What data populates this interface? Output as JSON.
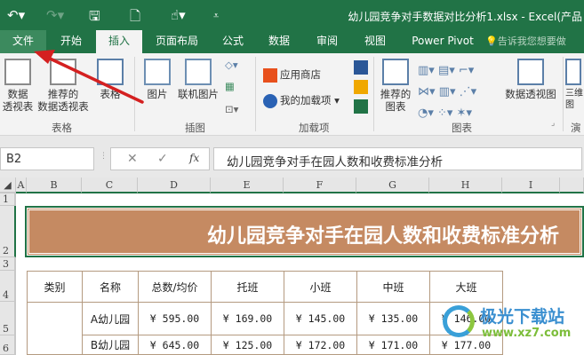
{
  "window": {
    "title": "幼儿园竞争对手数据对比分析1.xlsx - Excel(产品"
  },
  "tabs": [
    "文件",
    "开始",
    "插入",
    "页面布局",
    "公式",
    "数据",
    "审阅",
    "视图",
    "Power Pivot"
  ],
  "tell_me": "告诉我您想要做",
  "ribbon": {
    "table_group": {
      "label": "表格",
      "buttons": [
        "数据\n透视表",
        "推荐的\n数据透视表",
        "表格"
      ]
    },
    "illus_group": {
      "label": "插图",
      "buttons": [
        "图片",
        "联机图片"
      ]
    },
    "addins_group": {
      "label": "加载项",
      "store": "应用商店",
      "my_addins": "我的加载项"
    },
    "charts_group": {
      "label": "图表",
      "recommended": "推荐的\n图表",
      "pivot_chart": "数据透视图"
    },
    "next_group": {
      "label": "演",
      "button": "三维\n图"
    }
  },
  "formula_bar": {
    "name_box": "B2",
    "formula": "幼儿园竞争对手在园人数和收费标准分析",
    "fx": "fx"
  },
  "columns": [
    "A",
    "B",
    "C",
    "D",
    "E",
    "F",
    "G",
    "H",
    "I"
  ],
  "rows": [
    "1",
    "2",
    "3",
    "4",
    "5",
    "6"
  ],
  "sheet": {
    "banner": "幼儿园竞争对手在园人数和收费标准分析",
    "headers": [
      "类别",
      "名称",
      "总数/均价",
      "托班",
      "小班",
      "中班",
      "大班"
    ],
    "data": [
      [
        "",
        "A幼儿园",
        "¥  595.00",
        "¥  169.00",
        "¥  145.00",
        "¥  135.00",
        "¥  146.00"
      ],
      [
        "",
        "B幼儿园",
        "¥  645.00",
        "¥  125.00",
        "¥  172.00",
        "¥  171.00",
        "¥  177.00"
      ]
    ]
  },
  "watermark": {
    "name": "极光下载站",
    "url": "www.xz7.com"
  },
  "colors": {
    "excel_green": "#217346",
    "banner": "#c58a62",
    "annotation_arrow": "#d42020"
  }
}
